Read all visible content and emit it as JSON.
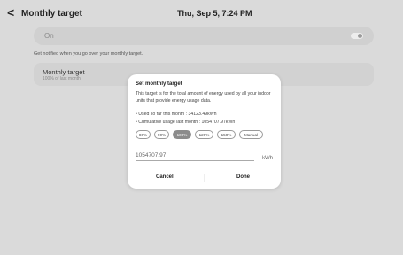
{
  "header": {
    "back_glyph": "<",
    "title": "Monthly target",
    "datetime": "Thu, Sep 5, 7:24 PM"
  },
  "settings": {
    "on_label": "On",
    "toggle_on": true,
    "notify_text": "Get notified when you go over your monthly target.",
    "target_title": "Monthly target",
    "target_sub": "100% of last month"
  },
  "dialog": {
    "title": "Set monthly target",
    "description": "This target is for the total amount of energy used by all your indoor units that provide energy usage data.",
    "used_so_far": "• Used so far this month : 34123.49kWh",
    "cumulative": "• Cumulative usage last month : 1054707.97kWh",
    "chips": [
      "80%",
      "90%",
      "100%",
      "120%",
      "150%",
      "Manual"
    ],
    "selected_chip": "100%",
    "input_value": "1054707.97",
    "unit": "kWh",
    "cancel_label": "Cancel",
    "done_label": "Done"
  },
  "colors": {
    "background": "#dadada",
    "dialog": "#ffffff",
    "chip_selected": "#8c8c8c"
  }
}
